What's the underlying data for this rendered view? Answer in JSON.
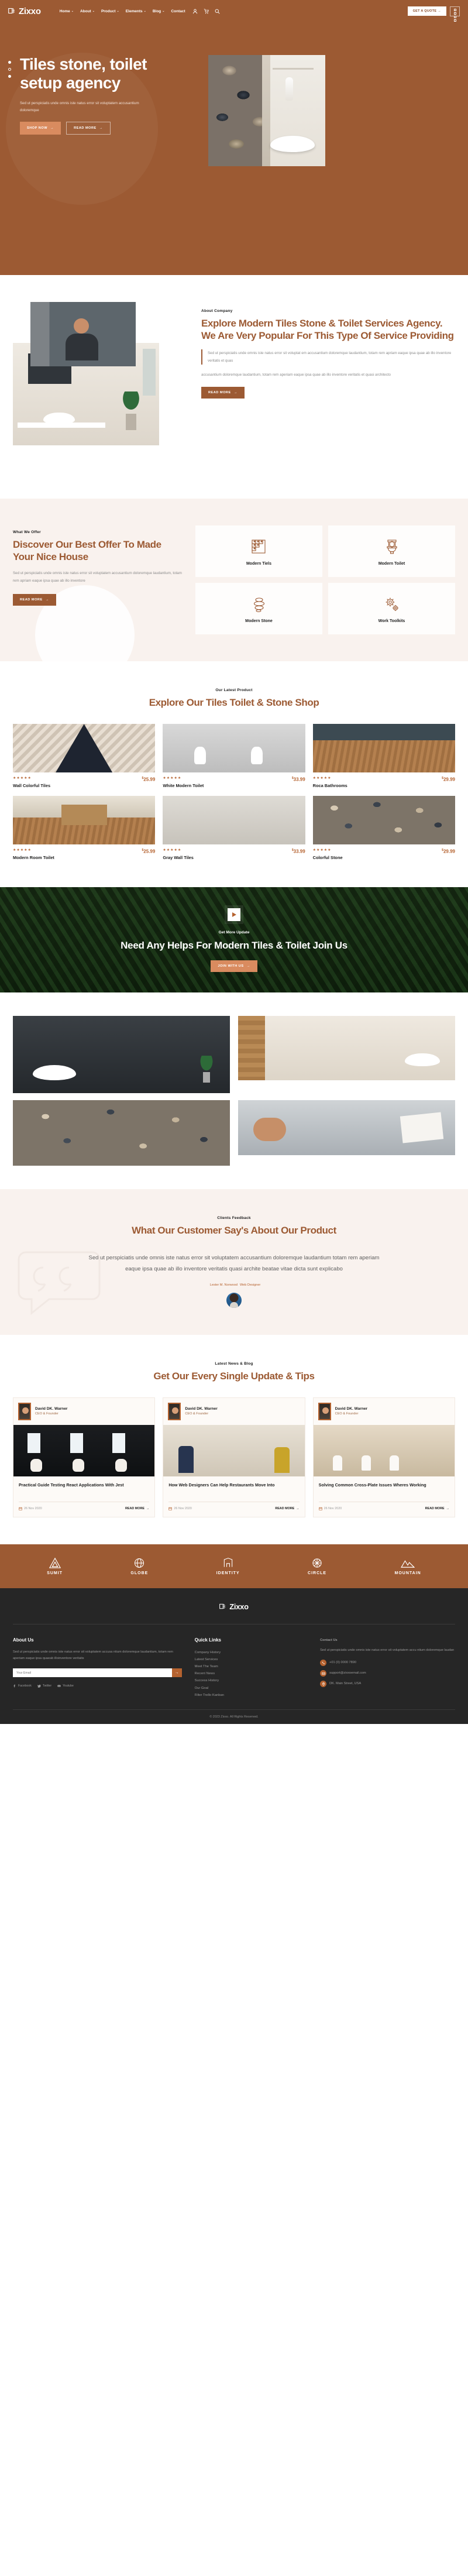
{
  "brand": {
    "name": "Zixxo",
    "accent": "#9c5a33",
    "accent_light": "#b5622f"
  },
  "header": {
    "nav": [
      {
        "label": "Home",
        "caret": "⌄"
      },
      {
        "label": "About",
        "caret": "⌄"
      },
      {
        "label": "Product",
        "caret": "⌄"
      },
      {
        "label": "Elements",
        "caret": "⌄"
      },
      {
        "label": "Blog",
        "caret": "⌄"
      },
      {
        "label": "Contact",
        "caret": ""
      }
    ],
    "icons": [
      "user-icon",
      "cart-icon",
      "search-icon"
    ],
    "quote_button": "GET A QUOTE  →"
  },
  "hero": {
    "title": "Tiles stone, toilet setup agency",
    "subtitle": "Sed ut perspiciatis unde omnis iste natus error sit voluptatem accusantium doloremque",
    "primary_button": "SHOP NOW",
    "secondary_button": "READ MORE",
    "arrow": "→"
  },
  "about": {
    "eyebrow": "About Company",
    "title": "Explore Modern Tiles Stone & Toilet Services Agency. We Are Very Popular For This Type Of Service Providing",
    "quote": "Sed ut perspiciatis unde omnis iste natus error sit voluptat em accusantium doloremque laudantium, totam rem apriam eaque ipsa quae ab illo inventore veritatis et quas",
    "paragraph": "accusantium doloremque laudantium, totam rem aperiam eaque ipsa quae ab illo inventore veritatis et quasi architecto",
    "button": "READ MORE"
  },
  "offer": {
    "eyebrow": "What We Offer",
    "title": "Discover Our Best Offer To Made Your Nice House",
    "paragraph": "Sed ut perspiciatis unde omnis iste natus error sit voluptatem accusantium doloremque laudantium, totam rem apriam eaque ipsa quae ab illo inventore",
    "button": "READ MORE",
    "cards": [
      {
        "label": "Modern Tiels",
        "icon": "tiles-icon"
      },
      {
        "label": "Modern Toilet",
        "icon": "toilet-icon"
      },
      {
        "label": "Modern Stone",
        "icon": "stone-stack-icon"
      },
      {
        "label": "Work Toolkits",
        "icon": "gears-icon"
      }
    ]
  },
  "products": {
    "eyebrow": "Our Latest Product",
    "title": "Explore Our Tiles Toilet & Stone Shop",
    "stars": "★★★★★",
    "currency": "$",
    "items": [
      {
        "name": "Wall Colorful Tiles",
        "price": "25.99",
        "thumb": "tiles-chevron"
      },
      {
        "name": "White Modern Toilet",
        "price": "33.99",
        "thumb": "toilet-pair"
      },
      {
        "name": "Roca Bathrooms",
        "price": "29.99",
        "thumb": "wood-floor"
      },
      {
        "name": "Modern Room Toilet",
        "price": "25.99",
        "thumb": "wood-bath"
      },
      {
        "name": "Gray Wall Tiles",
        "price": "33.99",
        "thumb": "gray-wall"
      },
      {
        "name": "Colorful Stone",
        "price": "29.99",
        "thumb": "pebbles"
      }
    ]
  },
  "cta": {
    "eyebrow": "Get More Update",
    "title": "Need Any Helps For Modern Tiles & Toilet Join Us",
    "button": "JOIN WITH US",
    "play_icon": "play-icon"
  },
  "testimonial": {
    "eyebrow": "Clients Feedback",
    "title": "What Our Customer Say's About Our Product",
    "quote": "Sed ut perspiciatis unde omnis iste natus error sit voluptatem accusantium doloremque laudantium totam rem aperiam eaque ipsa quae ab illo inventore veritatis quasi archite beatae vitae dicta sunt explicabo",
    "author": "Lester M. Norwood",
    "role": "Web Designer"
  },
  "blog": {
    "eyebrow": "Latest News & Blog",
    "title": "Get Our Every Single Update & Tips",
    "posts": [
      {
        "author": "David DK. Warner",
        "role": "CEO & Founder",
        "title": "Practical Guide Testing React Applications With Jest",
        "date": "26 Nov 2020",
        "more": "READ MORE"
      },
      {
        "author": "David DK. Warner",
        "role": "CEO & Founder",
        "title": "How Web Designers Can Help Restaurants Move Into",
        "date": "26 Nov 2020",
        "more": "READ MORE"
      },
      {
        "author": "David DK. Warner",
        "role": "CEO & Founder",
        "title": "Solving Common Cross-Plate Issues Wheres Working",
        "date": "26 Nov 2020",
        "more": "READ MORE"
      }
    ],
    "date_icon": "calendar-icon",
    "arrow": "→"
  },
  "brands": [
    {
      "name": "SUMIT",
      "icon": "triangle-icon"
    },
    {
      "name": "GLOBE",
      "icon": "globe-icon"
    },
    {
      "name": "IDENTITY",
      "icon": "identity-icon"
    },
    {
      "name": "CIRCLE",
      "icon": "circle-icon"
    },
    {
      "name": "MOUNTAIN",
      "icon": "mountain-icon"
    }
  ],
  "footer": {
    "about": {
      "heading": "About Us",
      "text": "Sed ut perspiciatis unde omnis iste natus error sit voluptatem accusa ntium doloremque laudantium, totam rem aperiam eaque ipsa quaeab illoinventore veritatis",
      "email_placeholder": "Your Email",
      "submit_icon": "→",
      "social": [
        "Facebook",
        "Twitter",
        "Youtube"
      ]
    },
    "quick_links": {
      "heading": "Quick Links",
      "items": [
        "Company History",
        "Latest Services",
        "Meet The Team",
        "Recent News",
        "Success History",
        "Our Goal",
        "Filter Trello Kanban"
      ]
    },
    "contact": {
      "heading": "Contact Us",
      "intro": "Sed ut perspiciatis unde omnis iste natus error sit voluptatem accu ntium doloremque laudan",
      "phone": "+01 (0) 0000 7890",
      "email": "support@zixxoemail.com",
      "address": "DK. Main Street, USA"
    },
    "copyright": "© 2023 Zixxo. All Rights Reserved."
  }
}
